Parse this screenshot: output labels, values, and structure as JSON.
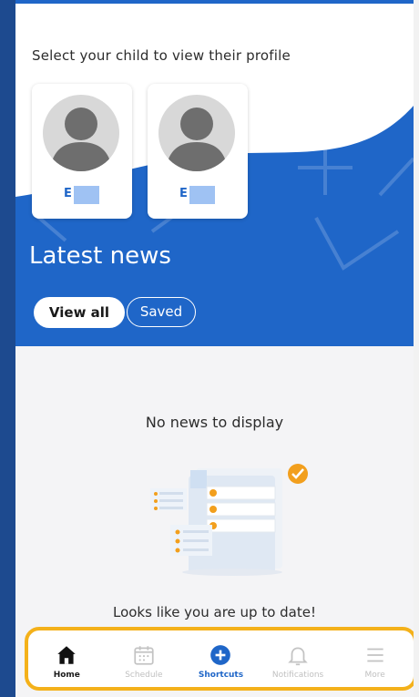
{
  "profiles": {
    "title": "Select your child to view their profile",
    "children": [
      {
        "initial": "E"
      },
      {
        "initial": "E"
      }
    ]
  },
  "news": {
    "heading": "Latest news",
    "filters": [
      {
        "label": "View all",
        "selected": true
      },
      {
        "label": "Saved",
        "selected": false
      }
    ],
    "empty_title": "No news to display",
    "empty_message": "Looks like you are up to date!"
  },
  "tabbar": {
    "items": [
      {
        "label": "Home",
        "icon": "home-icon",
        "state": "active"
      },
      {
        "label": "Schedule",
        "icon": "calendar-icon",
        "state": "disabled"
      },
      {
        "label": "Shortcuts",
        "icon": "plus-circle-icon",
        "state": "accent"
      },
      {
        "label": "Notifications",
        "icon": "bell-icon",
        "state": "disabled"
      },
      {
        "label": "More",
        "icon": "menu-icon",
        "state": "disabled"
      }
    ]
  },
  "colors": {
    "brand_blue": "#1f66c8",
    "highlight_border": "#f4b11a",
    "check_badge": "#f29f1d"
  }
}
